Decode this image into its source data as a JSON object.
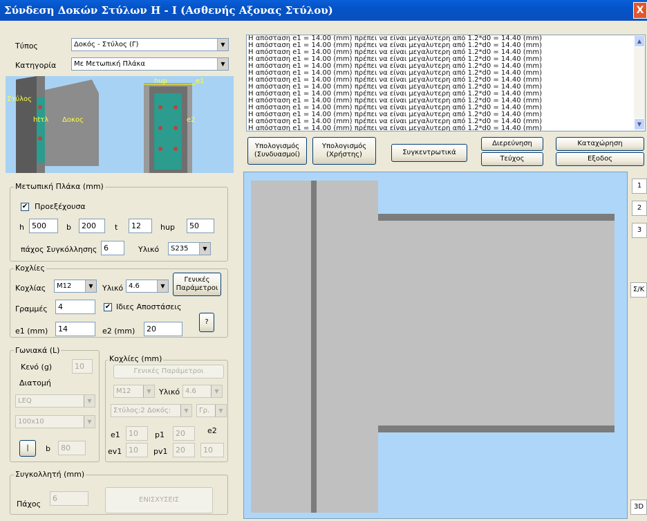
{
  "window": {
    "title": "Σύνδεση Δοκών Στύλων Η - Ι (Ασθενής Αξονας Στύλου)",
    "close": "X"
  },
  "top": {
    "type_label": "Τύπος",
    "type_value": "Δοκός - Στύλος (Γ)",
    "cat_label": "Κατηγορία",
    "cat_value": "Με Μετωπική Πλάκα"
  },
  "preview": {
    "lbl_stylos": "Στύλος",
    "lbl_htl": "htτλ",
    "lbl_dokos": "Δοκος",
    "lbl_hup": "hup",
    "lbl_e1": "e1",
    "lbl_e2": "e2"
  },
  "plate": {
    "legend": "Μετωπική Πλάκα (mm)",
    "protruding_label": "Προεξέχουσα",
    "protruding_checked": "✔",
    "h_label": "h",
    "h": "500",
    "b_label": "b",
    "b": "200",
    "t_label": "t",
    "t": "12",
    "hup_label": "hup",
    "hup": "50",
    "weld_label": "πάχος Συγκόλλησης",
    "weld": "6",
    "mat_label": "Υλικό",
    "mat": "S235"
  },
  "bolts": {
    "legend": "Κοχλίες",
    "bolt_label": "Κοχλίας",
    "bolt": "M12",
    "mat_label": "Υλικό",
    "mat": "4.6",
    "general_btn": "Γενικές Παράμετροι",
    "rows_label": "Γραμμές",
    "rows": "4",
    "same_label": "Ιδιες Αποστάσεις",
    "same_checked": "✔",
    "e1_label": "e1 (mm)",
    "e1": "14",
    "e2_label": "e2 (mm)",
    "e2": "20",
    "help_btn": "?"
  },
  "angles": {
    "legend": "Γωνιακά (L)",
    "gap_label": "Κενό (g)",
    "gap": "10",
    "section_legend": "Διατομή",
    "section": "LEQ",
    "size": "100x10",
    "small_btn": "|",
    "b_label": "b",
    "b": "80"
  },
  "bolts2": {
    "legend": "Κοχλίες (mm)",
    "general_btn": "Γενικές Παράμετροι",
    "bolt": "M12",
    "mat_label": "Υλικό",
    "mat": "4.6",
    "pos": "Στύλος:2 Δοκός:",
    "pos2": "Γρ.",
    "e1_label": "e1",
    "e1": "10",
    "p1_label": "p1",
    "p1": "20",
    "e2_label": "e2",
    "ev1_label": "ev1",
    "ev1": "10",
    "pv1_label": "pv1",
    "pv1": "20",
    "e2val": "10"
  },
  "weld": {
    "legend": "Συγκολλητή (mm)",
    "thick_label": "Πάχος",
    "thick": "6",
    "reinforce_btn": "ΕΝΙΣΧΥΣΕΙΣ"
  },
  "log": {
    "lines": [
      "Η απόσταση e1 = 14.00 (mm) πρέπει να είναι μεγαλυτερη από 1.2*d0 = 14.40 (mm)",
      "Η απόσταση e1 = 14.00 (mm) πρέπει να είναι μεγαλυτερη από 1.2*d0 = 14.40 (mm)",
      "Η απόσταση e1 = 14.00 (mm) πρέπει να είναι μεγαλυτερη από 1.2*d0 = 14.40 (mm)",
      "Η απόσταση e1 = 14.00 (mm) πρέπει να είναι μεγαλυτερη από 1.2*d0 = 14.40 (mm)",
      "Η απόσταση e1 = 14.00 (mm) πρέπει να είναι μεγαλυτερη από 1.2*d0 = 14.40 (mm)",
      "Η απόσταση e1 = 14.00 (mm) πρέπει να είναι μεγαλυτερη από 1.2*d0 = 14.40 (mm)",
      "Η απόσταση e1 = 14.00 (mm) πρέπει να είναι μεγαλυτερη από 1.2*d0 = 14.40 (mm)",
      "Η απόσταση e1 = 14.00 (mm) πρέπει να είναι μεγαλυτερη από 1.2*d0 = 14.40 (mm)",
      "Η απόσταση e1 = 14.00 (mm) πρέπει να είναι μεγαλυτερη από 1.2*d0 = 14.40 (mm)",
      "Η απόσταση e1 = 14.00 (mm) πρέπει να είναι μεγαλυτερη από 1.2*d0 = 14.40 (mm)",
      "Η απόσταση e1 = 14.00 (mm) πρέπει να είναι μεγαλυτερη από 1.2*d0 = 14.40 (mm)",
      "Η απόσταση e1 = 14.00 (mm) πρέπει να είναι μεγαλυτερη από 1.2*d0 = 14.40 (mm)",
      "Η απόσταση e1 = 14.00 (mm) πρέπει να είναι μεγαλυτερη από 1.2*d0 = 14.40 (mm)",
      "Η απόσταση e1 = 14.00 (mm) πρέπει να είναι μεγαλυτερη από 1.2*d0 = 14.40 (mm)"
    ]
  },
  "actions": {
    "calc_combo": "Υπολογισμός (Συνδυασμοί)",
    "calc_user": "Υπολογισμός (Χρήστης)",
    "summary": "Συγκεντρωτικά",
    "investigate": "Διερεύνηση",
    "booklet": "Τεύχος",
    "register": "Καταχώρηση",
    "exit": "Εξοδος"
  },
  "side": {
    "b1": "1",
    "b2": "2",
    "b3": "3",
    "sk": "Σ/Κ",
    "threeD": "3D"
  },
  "colors": {
    "canvas_bg": "#aed6f8",
    "steel": "#c0c0c0",
    "steel_dark": "#808080"
  }
}
